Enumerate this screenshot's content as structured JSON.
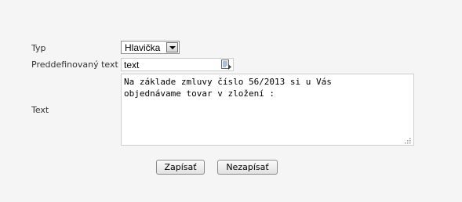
{
  "form": {
    "type_label": "Typ",
    "type_value": "Hlavička",
    "predefined_label": "Preddefinovaný text",
    "predefined_value": "text",
    "text_label": "Text",
    "text_value": "Na základe zmluvy číslo 56/2013 si u Vás\nobjednávame tovar v zložení :"
  },
  "buttons": {
    "save_label": "Zapísať",
    "cancel_label": "Nezapísať"
  },
  "icons": {
    "dropdown": "chevron-down-icon",
    "picker": "list-picker-icon",
    "resize": "resize-grip-icon"
  }
}
